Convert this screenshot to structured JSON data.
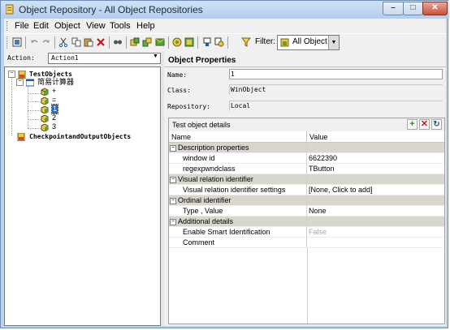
{
  "window": {
    "title": "Object Repository - All Object Repositories"
  },
  "menu": {
    "items": [
      "File",
      "Edit",
      "Object",
      "View",
      "Tools",
      "Help"
    ]
  },
  "toolbar": {
    "filter_label": "Filter:",
    "filter_value": "All Object"
  },
  "left": {
    "action_label": "Action:",
    "action_value": "Action1",
    "tree": {
      "root": "TestObjects",
      "window": "简易计算器",
      "children": [
        "+",
        "=",
        "1",
        "2",
        "3"
      ],
      "checkpoints": "CheckpointandOutputObjects"
    }
  },
  "props": {
    "title": "Object Properties",
    "name_label": "Name:",
    "name_value": "1",
    "class_label": "Class:",
    "class_value": "WinObject",
    "repo_label": "Repository:",
    "repo_value": "Local"
  },
  "details": {
    "title": "Test object details",
    "col_name": "Name",
    "col_value": "Value",
    "rows": [
      {
        "cat": "Description properties"
      },
      {
        "name": "window id",
        "value": "6622390"
      },
      {
        "name": "regexpwndclass",
        "value": "TButton"
      },
      {
        "cat": "Visual relation identifier"
      },
      {
        "name": "Visual relation identifier settings",
        "value": "[None, Click to add]"
      },
      {
        "cat": "Ordinal identifier"
      },
      {
        "name": "Type , Value",
        "value": "None"
      },
      {
        "cat": "Additional details"
      },
      {
        "name": "Enable Smart Identification",
        "value": "False"
      },
      {
        "name": "Comment",
        "value": ""
      }
    ]
  },
  "colors": {
    "accent": "#3169c6",
    "category_row": "#d8d6cd",
    "titlebar": "#bcd3ee"
  }
}
